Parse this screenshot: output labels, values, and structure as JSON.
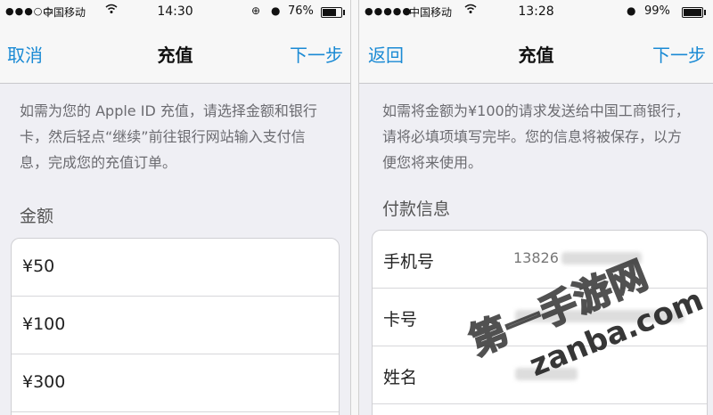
{
  "left": {
    "status": {
      "signal": "●●●○○",
      "carrier": "中国移动",
      "time": "14:30",
      "battery_text": "76%",
      "battery_level": 0.76
    },
    "nav": {
      "left": "取消",
      "title": "充值",
      "right": "下一步"
    },
    "description": "如需为您的 Apple ID 充值，请选择金额和银行卡，然后轻点“继续”前往银行网站输入支付信息，完成您的充值订单。",
    "section": "金额",
    "amounts": [
      "¥50",
      "¥100",
      "¥300"
    ]
  },
  "right": {
    "status": {
      "signal": "●●●●●",
      "carrier": "中国移动",
      "time": "13:28",
      "battery_text": "99%",
      "battery_level": 0.99
    },
    "nav": {
      "left": "返回",
      "title": "充值",
      "right": "下一步"
    },
    "description": "如需将金额为¥100的请求发送给中国工商银行，请将必填项填写完毕。您的信息将被保存，以方便您将来使用。",
    "section": "付款信息",
    "fields": [
      {
        "label": "手机号",
        "value": "13826"
      },
      {
        "label": "卡号",
        "value": ""
      },
      {
        "label": "姓名",
        "value": ""
      }
    ]
  },
  "watermark": {
    "line1": "第一手游网",
    "line2": "zanba.com"
  },
  "colors": {
    "accent": "#1a8ad4",
    "background": "#efeff4"
  }
}
